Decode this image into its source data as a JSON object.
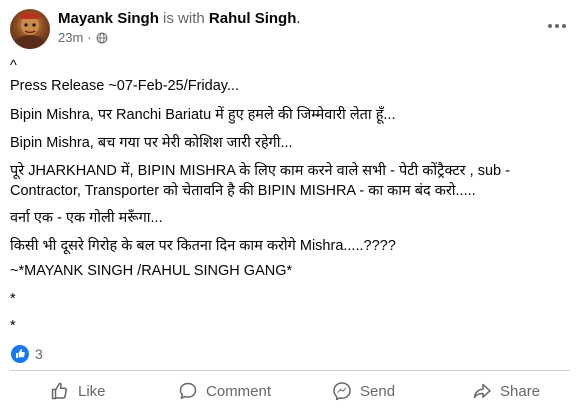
{
  "post": {
    "author": "Mayank Singh",
    "with_text": "is with",
    "tagged": "Rahul Singh",
    "period": ".",
    "time": "23m",
    "separator": "·",
    "body_lines": [
      "^",
      "Press Release ~07-Feb-25/Friday...",
      "Bipin Mishra, पर Ranchi Bariatu में हुए हमले की जिम्मेवारी लेता हूँ...",
      "Bipin Mishra, बच गया पर मेरी कोशिश जारी रहेगी...",
      "पूरे JHARKHAND में, BIPIN MISHRA के लिए काम करने वाले सभी - पेटी कोंट्रैक्टर , sub -",
      "Contractor, Transporter को चेतावनि है की BIPIN MISHRA - का काम बंद करो.....",
      "वर्ना एक - एक गोली मरूँगा...",
      "किसी भी दूसरे गिरोह के बल पर कितना दिन काम करोगे Mishra.....????",
      "~*MAYANK SINGH /RAHUL SINGH GANG*",
      "*",
      "*"
    ],
    "reaction_count": "3"
  },
  "actions": {
    "like": "Like",
    "comment": "Comment",
    "send": "Send",
    "share": "Share"
  },
  "icons": {
    "privacy": "globe-icon",
    "more": "more-horizontal-icon",
    "reaction": "like-reaction-icon",
    "like": "thumbs-up-icon",
    "comment": "comment-bubble-icon",
    "send": "messenger-icon",
    "share": "share-arrow-icon"
  },
  "colors": {
    "text": "#050505",
    "secondary": "#65676b",
    "like_blue": "#1877f2",
    "divider": "#ced0d4"
  }
}
